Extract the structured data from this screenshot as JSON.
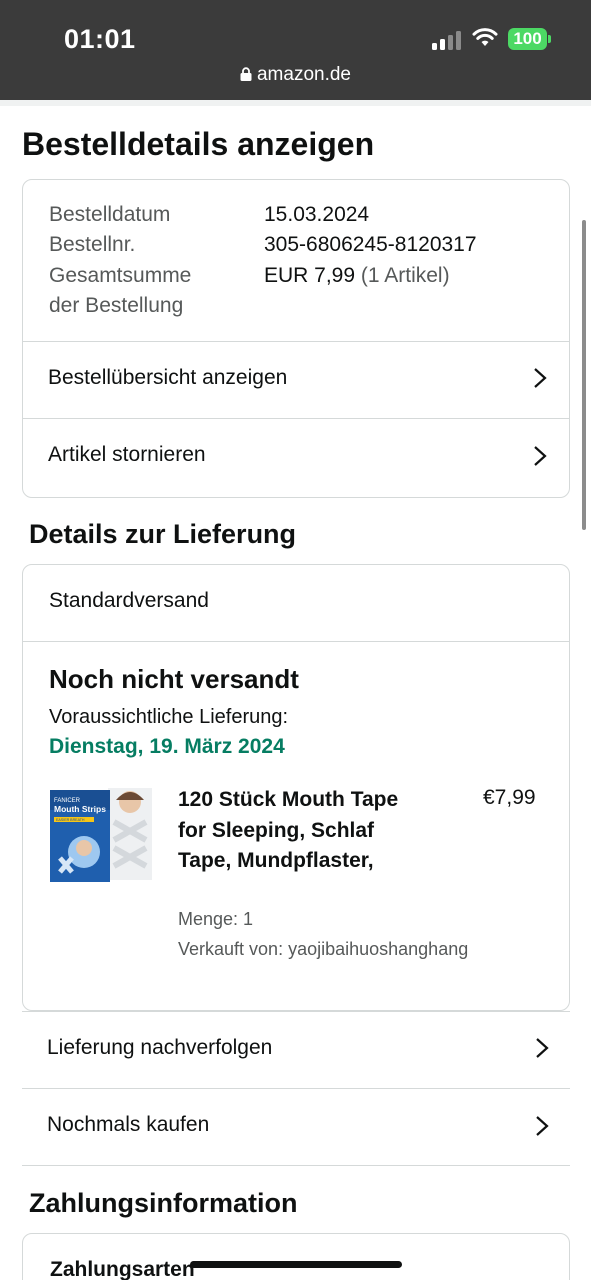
{
  "status_bar": {
    "time": "01:01",
    "battery": "100",
    "url": "amazon.de",
    "icons": [
      "signal-icon",
      "wifi-icon",
      "battery-icon",
      "lock-icon"
    ]
  },
  "page": {
    "title": "Bestelldetails anzeigen"
  },
  "order_summary": {
    "date_label": "Bestelldatum",
    "date_value": "15.03.2024",
    "number_label": "Bestellnr.",
    "number_value": "305-6806245-8120317",
    "total_label_line1": "Gesamtsumme",
    "total_label_line2": "der Bestellung",
    "total_value": "EUR 7,99",
    "total_count": "(1 Artikel)",
    "links": [
      {
        "label": "Bestellübersicht anzeigen"
      },
      {
        "label": "Artikel stornieren"
      }
    ]
  },
  "delivery": {
    "section_title": "Details zur Lieferung",
    "shipping_method": "Standardversand",
    "status": "Noch nicht versandt",
    "eta_label": "Voraussichtliche Lieferung:",
    "eta_date": "Dienstag, 19. März 2024",
    "product": {
      "title": "120 Stück Mouth Tape for Sleeping, Schlaf Tape, Mundpflaster,",
      "price": "€7,99",
      "quantity": "Menge: 1",
      "seller": "Verkauft von: yaojibaihuoshanghang",
      "image_box_text": [
        "FANICER",
        "Mouth Strips",
        "EASIER BREATH"
      ]
    },
    "links": [
      {
        "label": "Lieferung nachverfolgen"
      },
      {
        "label": "Nochmals kaufen"
      }
    ]
  },
  "payment": {
    "section_title": "Zahlungsinformation",
    "methods_label": "Zahlungsarten"
  },
  "colors": {
    "status_bar_bg": "#3b3b3b",
    "battery_green": "#4cd964",
    "delivery_green": "#067d62",
    "border": "#d5d9d9",
    "text": "#0f1111",
    "muted_text": "#565959"
  }
}
